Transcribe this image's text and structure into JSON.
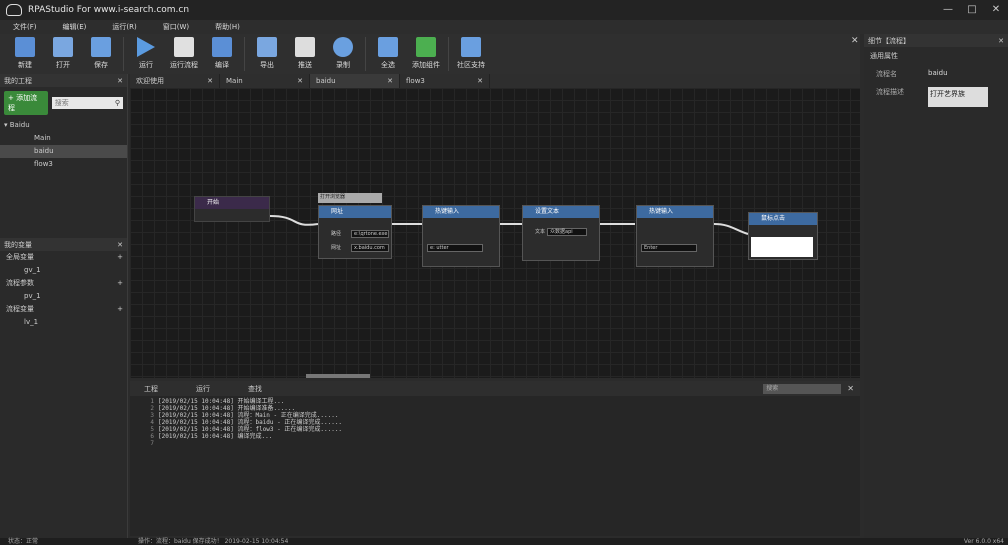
{
  "title": "RPAStudio For www.i-search.com.cn",
  "menu": [
    "文件(F)",
    "编辑(E)",
    "运行(R)",
    "窗口(W)",
    "帮助(H)"
  ],
  "toolbar": [
    {
      "label": "新建",
      "icon": "new-icon",
      "color": "#5b8fd6"
    },
    {
      "label": "打开",
      "icon": "open-icon",
      "color": "#7aa7e0"
    },
    {
      "label": "保存",
      "icon": "save-icon",
      "color": "#6a9fe0"
    },
    {
      "label": "运行",
      "icon": "run-icon",
      "color": "#5b9be0"
    },
    {
      "label": "运行流程",
      "icon": "run-flow-icon",
      "color": "#e0e0e0"
    },
    {
      "label": "编译",
      "icon": "compile-icon",
      "color": "#5b8fd6"
    },
    {
      "label": "导出",
      "icon": "export-icon",
      "color": "#7aa7e0"
    },
    {
      "label": "推送",
      "icon": "push-icon",
      "color": "#ddd"
    },
    {
      "label": "录制",
      "icon": "record-icon",
      "color": "#6aa0e0"
    },
    {
      "label": "全选",
      "icon": "select-all-icon",
      "color": "#6a9fe0"
    },
    {
      "label": "添加组件",
      "icon": "add-component-icon",
      "color": "#4caf50"
    },
    {
      "label": "社区支持",
      "icon": "community-icon",
      "color": "#6a9fe0"
    }
  ],
  "project": {
    "title": "我的工程",
    "add_label": "+ 添加流程",
    "search_placeholder": "搜索",
    "root": "Baidu",
    "items": [
      "Main",
      "baidu",
      "flow3"
    ]
  },
  "variables": {
    "title": "我的变量",
    "groups": [
      {
        "name": "全局变量",
        "var": "gv_1"
      },
      {
        "name": "流程参数",
        "var": "pv_1"
      },
      {
        "name": "流程变量",
        "var": "lv_1"
      }
    ]
  },
  "tabs": [
    "欢迎使用",
    "Main",
    "baidu",
    "flow3"
  ],
  "nodes": {
    "start": "开始",
    "browser_title": "打开浏览器",
    "browser_head": "网址",
    "path_label": "路径",
    "path_val": "e:\\qrtone.exe",
    "url_label": "网址",
    "url_val": "x.baidu.com",
    "input1": "热键输入",
    "input1_field": "e: utter",
    "setText": "设置文本",
    "setText_label": "文本",
    "setText_val": "众数据api",
    "input2": "热键输入",
    "input2_field": "Enter",
    "click": "鼠标点击"
  },
  "bottom": {
    "tabs": [
      "工程",
      "运行",
      "查找"
    ],
    "search_placeholder": "搜索",
    "log": [
      "[2019/02/15 10:04:48] 开始编译工程...",
      "[2019/02/15 10:04:48] 开始编译准备......",
      "[2019/02/15 10:04:48] 流程：Main - 正在编译完成......",
      "[2019/02/15 10:04:48] 流程：baidu - 正在编译完成......",
      "[2019/02/15 10:04:48] 流程：flow3 - 正在编译完成......",
      "[2019/02/15 10:04:48] 编译完成...",
      ""
    ]
  },
  "details": {
    "title": "细节【流程】",
    "section": "通用属性",
    "name_label": "流程名",
    "name_val": "baidu",
    "desc_label": "流程描述",
    "desc_val": "打开艺界族"
  },
  "status": {
    "left": "状态：正常",
    "mid": "操作：流程：baidu 保存成功！ 2019-02-15 10:04:54",
    "right": "Ver 6.0.0 x64"
  }
}
